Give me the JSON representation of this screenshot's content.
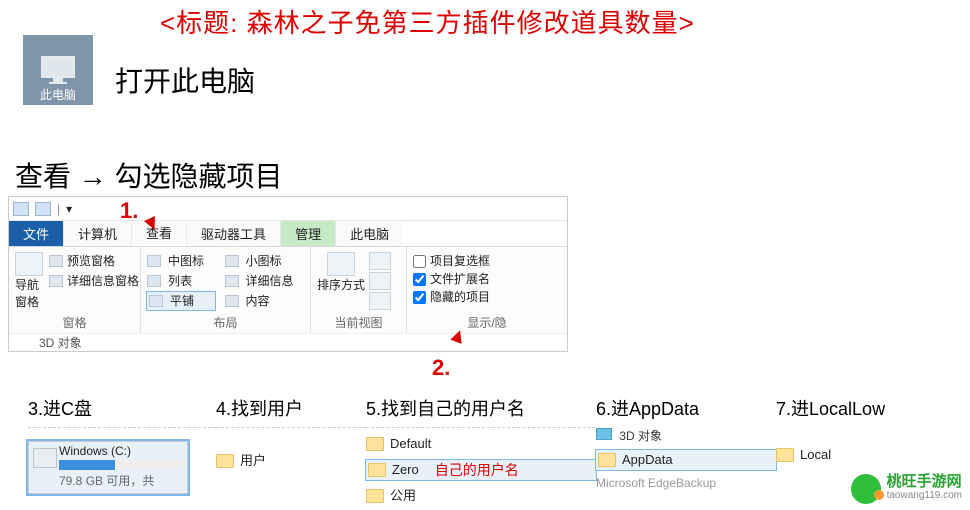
{
  "anno": {
    "title": "<标题: 森林之子免第三方插件修改道具数量>",
    "n1": "1.",
    "n2": "2."
  },
  "desktop": {
    "thispc_label": "此电脑"
  },
  "banner": {
    "step_open": "打开此电脑",
    "step_view": "查看 → 勾选隐藏项目"
  },
  "ribbon": {
    "tabs": {
      "file": "文件",
      "computer": "计算机",
      "view": "查看",
      "drive_tools": "驱动器工具",
      "manage": "管理",
      "context": "此电脑"
    },
    "panes": {
      "nav_pane": "导航窗格",
      "preview": "预览窗格",
      "details": "详细信息窗格",
      "group_label": "窗格"
    },
    "layout": {
      "medium_icons": "中图标",
      "small_icons": "小图标",
      "list": "列表",
      "details": "详细信息",
      "tiles": "平铺",
      "content": "内容",
      "group_label": "布局"
    },
    "currentview": {
      "sort_by": "排序方式",
      "group_label": "当前视图"
    },
    "showhide": {
      "item_checkboxes": "项目复选框",
      "file_ext": "文件扩展名",
      "hidden_items": "隐藏的项目",
      "group_label": "显示/隐"
    },
    "below_row": "3D 对象"
  },
  "steps": {
    "s3": {
      "title": "3.进C盘",
      "drive_name": "Windows (C:)",
      "drive_sub": "79.8 GB 可用，共"
    },
    "s4": {
      "title": "4.找到用户",
      "item": "用户"
    },
    "s5": {
      "title": "5.找到自己的用户名",
      "items": [
        "Default",
        "Zero",
        "公用"
      ],
      "hint": "自己的用户名"
    },
    "s6": {
      "title": "6.进AppData",
      "rows": [
        "3D 对象",
        "AppData"
      ],
      "cut": "Microsoft EdgeBackup"
    },
    "s7": {
      "title": "7.进LocalLow",
      "row": "Local"
    }
  },
  "watermark": {
    "name": "桃旺手游网",
    "url": "taowang119.com"
  }
}
